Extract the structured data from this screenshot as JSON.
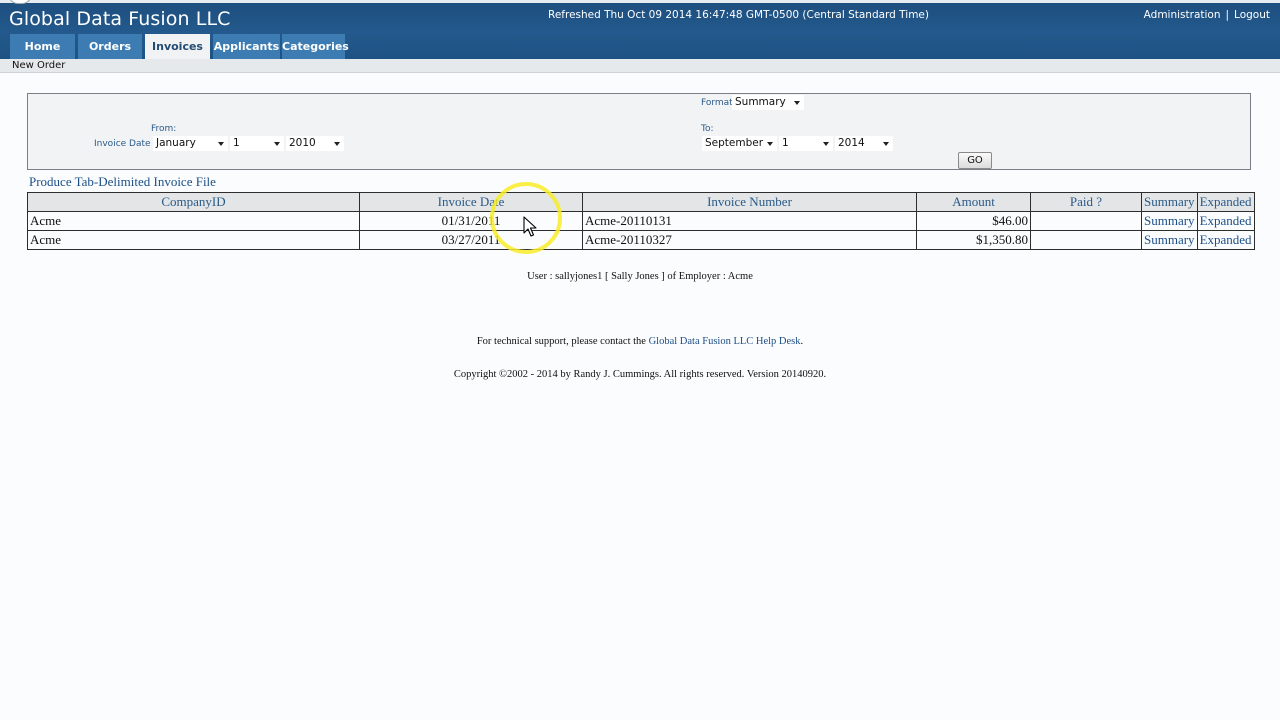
{
  "header": {
    "app_title": "Global Data Fusion LLC",
    "refreshed": "Refreshed Thu Oct 09 2014 16:47:48 GMT-0500 (Central Standard Time)",
    "links": {
      "administration": "Administration",
      "separator": "|",
      "logout": "Logout"
    }
  },
  "tabs": [
    {
      "label": "Home",
      "active": false
    },
    {
      "label": "Orders",
      "active": false
    },
    {
      "label": "Invoices",
      "active": true
    },
    {
      "label": "Applicants",
      "active": false
    },
    {
      "label": "Categories",
      "active": false
    }
  ],
  "subnav": {
    "new_order": "New Order"
  },
  "filter": {
    "format_label": "Format",
    "format_value": "Summary",
    "from_label": "From:",
    "invoice_date_label": "Invoice Date",
    "from_month": "January",
    "from_day": "1",
    "from_year": "2010",
    "to_label": "To:",
    "to_month": "September",
    "to_day": "1",
    "to_year": "2014",
    "go_label": "GO"
  },
  "produce_link": "Produce Tab-Delimited Invoice File",
  "table": {
    "headers": {
      "company": "CompanyID",
      "invoice_date": "Invoice Date",
      "invoice_number": "Invoice Number",
      "amount": "Amount",
      "paid": "Paid ?",
      "summary": "Summary",
      "expanded": "Expanded"
    },
    "rows": [
      {
        "company": "Acme",
        "invoice_date": "01/31/2011",
        "invoice_number": "Acme-20110131",
        "amount": "$46.00",
        "paid": "",
        "summary": "Summary",
        "expanded": "Expanded"
      },
      {
        "company": "Acme",
        "invoice_date": "03/27/2011",
        "invoice_number": "Acme-20110327",
        "amount": "$1,350.80",
        "paid": "",
        "summary": "Summary",
        "expanded": "Expanded"
      }
    ]
  },
  "footer": {
    "user_line": "User : sallyjones1 [ Sally Jones ] of Employer : Acme",
    "support_prefix": "For technical support, please contact the ",
    "support_link": "Global Data Fusion LLC Help Desk",
    "support_suffix": ".",
    "copyright": "Copyright ©2002 - 2014 by Randy J. Cummings. All rights reserved. Version 20140920."
  },
  "icons": {
    "select_arrow": "chevron-down-icon",
    "pointer": "mouse-pointer-icon",
    "highlight": "cursor-highlight-ring"
  },
  "colors": {
    "header_bg": "#23598c",
    "tab_bg": "#3d7cb3",
    "link": "#1c4f86",
    "highlight": "#f8ec28"
  }
}
